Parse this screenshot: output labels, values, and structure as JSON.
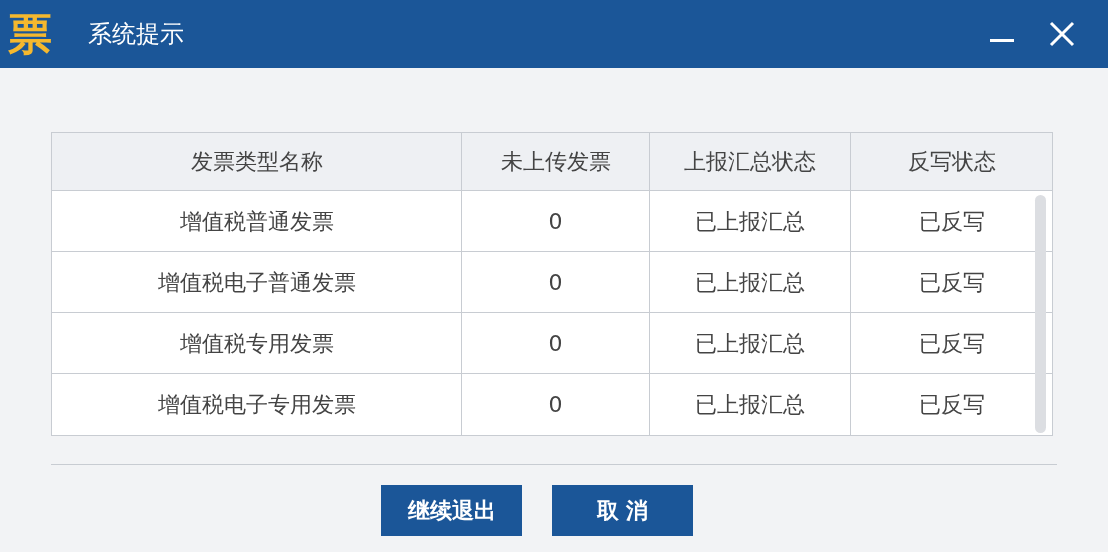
{
  "window": {
    "logo": "票",
    "title": "系统提示"
  },
  "table": {
    "columns": [
      "发票类型名称",
      "未上传发票",
      "上报汇总状态",
      "反写状态"
    ],
    "rows": [
      [
        "增值税普通发票",
        "0",
        "已上报汇总",
        "已反写"
      ],
      [
        "增值税电子普通发票",
        "0",
        "已上报汇总",
        "已反写"
      ],
      [
        "增值税专用发票",
        "0",
        "已上报汇总",
        "已反写"
      ],
      [
        "增值税电子专用发票",
        "0",
        "已上报汇总",
        "已反写"
      ]
    ]
  },
  "buttons": [
    "继续退出",
    "取 消"
  ]
}
